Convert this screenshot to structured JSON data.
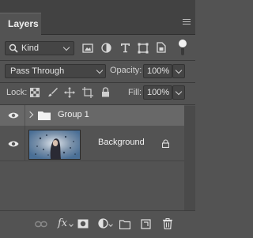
{
  "panel": {
    "tab_label": "Layers"
  },
  "filter": {
    "kind_label": "Kind"
  },
  "blend": {
    "mode": "Pass Through",
    "opacity_label": "Opacity:",
    "opacity_value": "100%"
  },
  "lock": {
    "label": "Lock:",
    "fill_label": "Fill:",
    "fill_value": "100%"
  },
  "layers": [
    {
      "name": "Group 1",
      "type": "group",
      "visible": true,
      "selected": true
    },
    {
      "name": "Background",
      "type": "image",
      "visible": true,
      "locked": true
    }
  ],
  "bottom_icons": [
    "link-layers-icon",
    "fx-icon",
    "add-mask-icon",
    "adjustment-layer-icon",
    "new-group-icon",
    "new-layer-icon",
    "delete-layer-icon"
  ],
  "bottom": {
    "fx_label": "fx"
  }
}
